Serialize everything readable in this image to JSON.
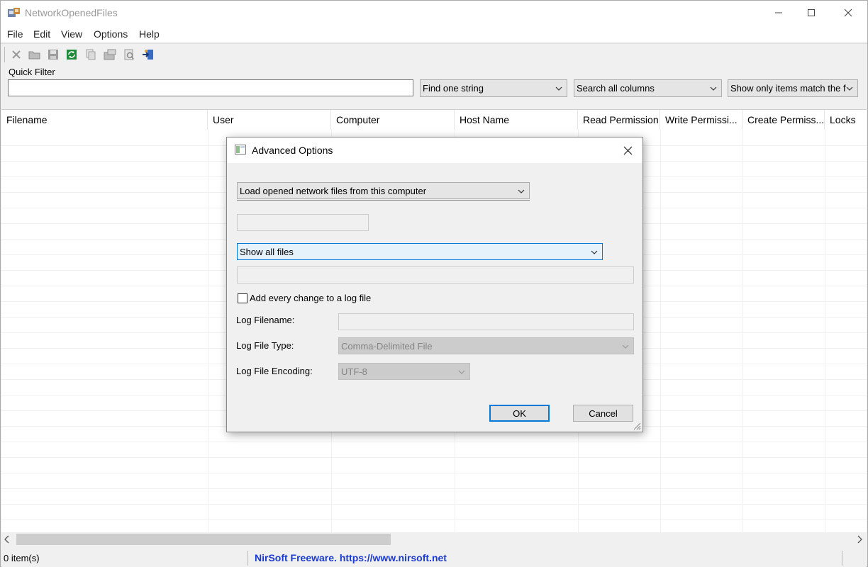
{
  "window": {
    "title": "NetworkOpenedFiles"
  },
  "menu": [
    "File",
    "Edit",
    "View",
    "Options",
    "Help"
  ],
  "toolbar": {
    "buttons": [
      "delete-icon",
      "open-folder-icon",
      "save-icon",
      "refresh-icon",
      "copy-icon",
      "properties-icon",
      "html-report-icon",
      "exit-icon"
    ]
  },
  "quick_filter": {
    "label": "Quick Filter",
    "value": "",
    "mode": "Find one string",
    "scope": "Search all columns",
    "show": "Show only items match the f"
  },
  "list": {
    "columns": [
      "Filename",
      "User",
      "Computer",
      "Host Name",
      "Read Permission",
      "Write Permissi...",
      "Create Permiss...",
      "Locks"
    ]
  },
  "statusbar": {
    "count": "0 item(s)",
    "link": "NirSoft Freeware. https://www.nirsoft.net"
  },
  "dialog": {
    "title": "Advanced Options",
    "source_select": "Load opened network files from this computer",
    "files_select": "Show all files",
    "log_checkbox_label": "Add every change to a log file",
    "log_checked": false,
    "log_filename_label": "Log Filename:",
    "log_filename_value": "",
    "log_type_label": "Log File Type:",
    "log_type_value": "Comma-Delimited File",
    "log_encoding_label": "Log File Encoding:",
    "log_encoding_value": "UTF-8",
    "ok_label": "OK",
    "cancel_label": "Cancel"
  },
  "colors": {
    "accent": "#0078d7",
    "link": "#1a3bcf"
  }
}
